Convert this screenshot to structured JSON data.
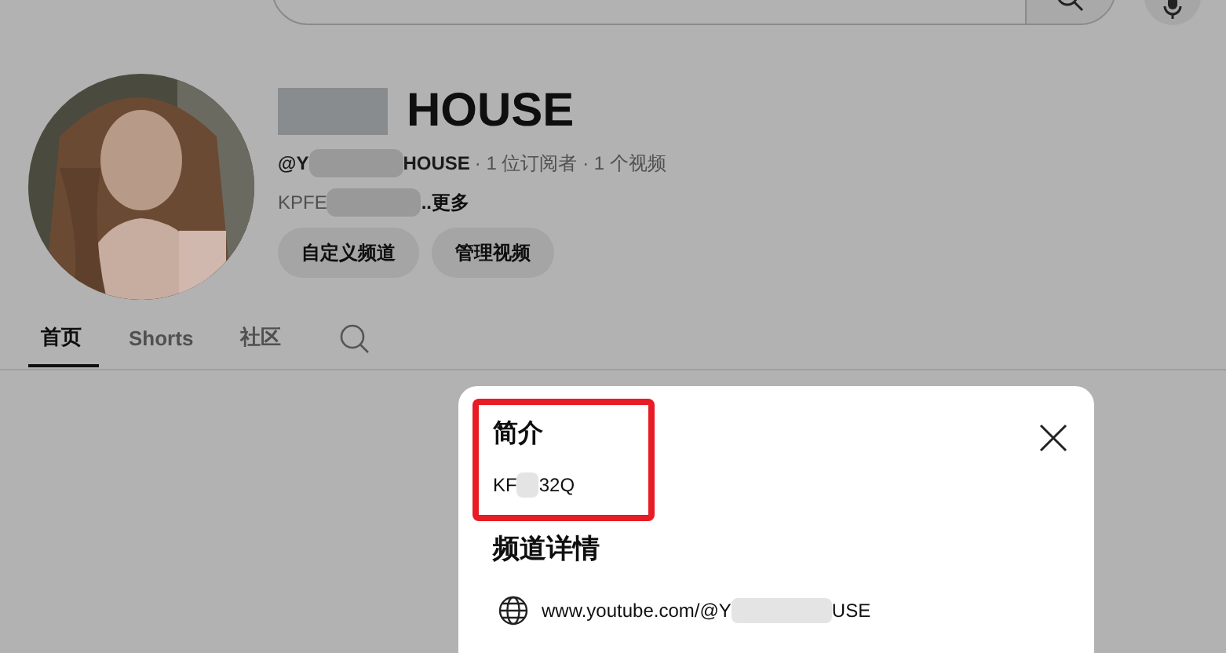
{
  "channel": {
    "title": "HOUSE",
    "handle_start": "@Y",
    "handle_end": "HOUSE",
    "stats": "· 1 位订阅者 · 1 个视频",
    "description_start": "KPFE",
    "more": "..更多"
  },
  "buttons": [
    "自定义频道",
    "管理视频"
  ],
  "tabs": [
    {
      "label": "首页",
      "selected": true
    },
    {
      "label": "Shorts",
      "selected": false
    },
    {
      "label": "社区",
      "selected": false
    }
  ],
  "dialog": {
    "about_heading": "简介",
    "about_start": "KF",
    "about_end": "32Q",
    "details_heading": "频道详情",
    "url_start": "www.youtube.com/@Y",
    "url_end": "USE"
  }
}
